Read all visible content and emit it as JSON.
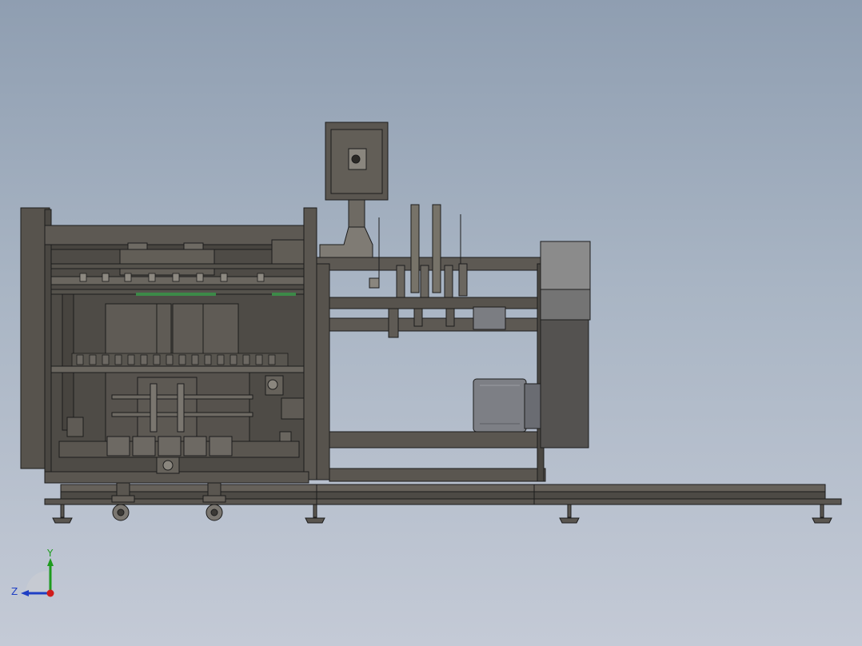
{
  "viewport": {
    "background_top": "#8f9eb1",
    "background_bottom": "#c4cad6"
  },
  "model": {
    "edge_color": "#1c1c1c",
    "body_color": "#5a5650",
    "panel_color": "#6a655e",
    "light_panel_color": "#8b8b8b",
    "motor_color": "#7d7f85",
    "accent_green": "#3c8a48"
  },
  "triad": {
    "y_label": "Y",
    "z_label": "Z",
    "y_color": "#1e9b1e",
    "z_color": "#1f3fc4",
    "x_color": "#d01c1c"
  }
}
